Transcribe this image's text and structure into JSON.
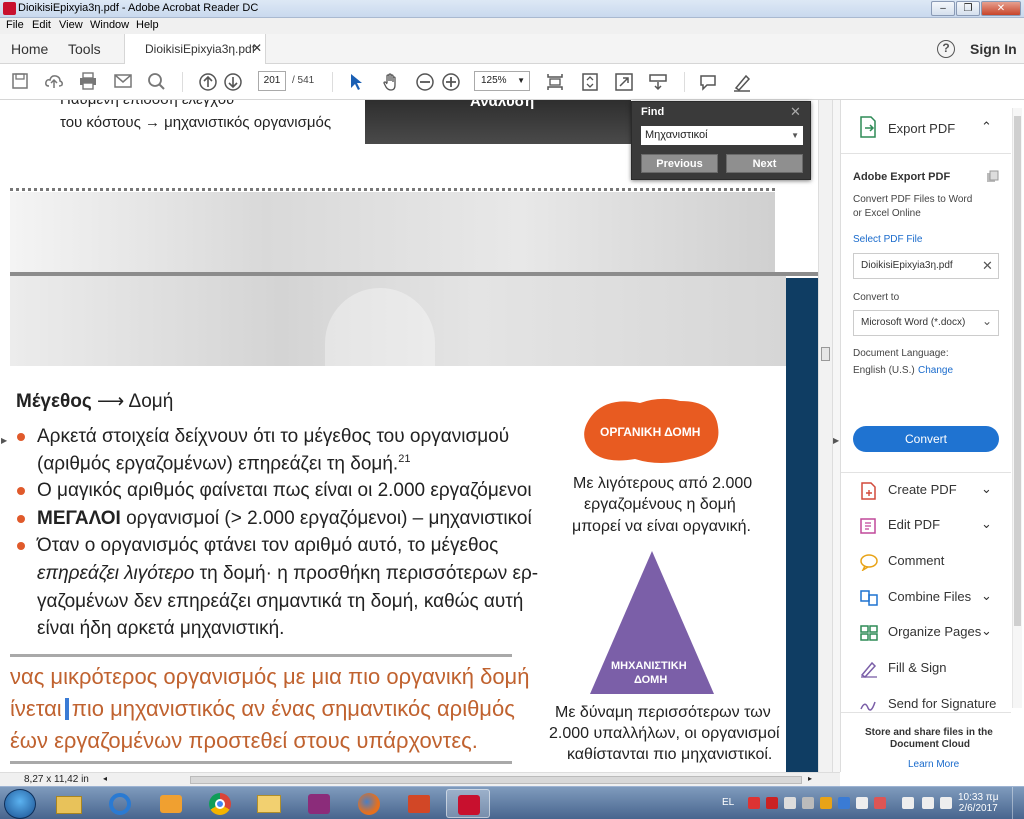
{
  "window": {
    "title": "DioikisiEpixyia3η.pdf - Adobe Acrobat Reader DC"
  },
  "menu": [
    "File",
    "Edit",
    "View",
    "Window",
    "Help"
  ],
  "tabs": {
    "home": "Home",
    "tools": "Tools",
    "doc": "DioikisiEpixyia3η.pdf",
    "sign_in": "Sign In"
  },
  "toolbar": {
    "page": "201",
    "page_total": "/ 541",
    "zoom": "125%"
  },
  "find": {
    "title": "Find",
    "value": "Μηχανιστικοί",
    "previous": "Previous",
    "next": "Next"
  },
  "doc": {
    "top_line1": "Ηαύμενη επίδοση ελέγχου",
    "top_line2": "του κόστους → μηχανιστικός οργανισμός",
    "top_dark_text": "Ανάλυση",
    "heading_bold": "Μέγεθος",
    "heading_arrow": "⟶",
    "heading_rest": "Δομή",
    "b1_l1": "Αρκετά στοιχεία δείχνουν ότι το μέγεθος του οργανισμού",
    "b1_l2": "(αριθμός εργαζομένων) επηρεάζει τη δομή.",
    "b1_sup": "21",
    "b2": "Ο μαγικός αριθμός φαίνεται πως είναι οι 2.000 εργαζόμενοι",
    "b3_bold": "ΜΕΓΑΛΟΙ",
    "b3_rest": " οργανισμοί (> 2.000 εργαζόμενοι) – μηχανιστικοί",
    "b4_l1": "Όταν ο οργανισμός φτάνει τον αριθμό αυτό, το μέγεθος",
    "b4_l2_ital": "επηρεάζει λιγότερο",
    "b4_l2_rest": " τη δομή· η προσθήκη περισσότερων ερ-",
    "b4_l3": "γαζομένων δεν επηρεάζει σημαντικά τη δομή, καθώς αυτή",
    "b4_l4": "είναι ήδη αρκετά μηχανιστική.",
    "quote_l1": "νας μικρότερος οργανισμός με μια πιο οργανική δομή",
    "quote_l2_a": "ίνεται",
    "quote_l2_b": "πιο μηχανιστικός αν ένας σημαντικός αριθμός",
    "quote_l3": "έων εργαζομένων προστεθεί στους υπάρχοντες.",
    "organic_label": "ΟΡΓΑΝΙΚΗ ΔΟΜΗ",
    "organic_cap1": "Με λιγότερους από 2.000",
    "organic_cap2": "εργαζομένους η δομή",
    "organic_cap3": "μπορεί να είναι οργανική.",
    "mech_label1": "ΜΗΧΑΝΙΣΤΙΚΗ",
    "mech_label2": "ΔΟΜΗ",
    "mech_cap1": "Με δύναμη περισσότερων των",
    "mech_cap2": "2.000 υπαλλήλων, οι οργανισμοί",
    "mech_cap3": "καθίστανται πιο μηχανιστικοί."
  },
  "panel": {
    "export_title": "Export PDF",
    "adobe_export": "Adobe Export PDF",
    "desc1": "Convert PDF Files to Word",
    "desc2": "or Excel Online",
    "select_file": "Select PDF File",
    "file_name": "DioikisiEpixyia3η.pdf",
    "convert_to": "Convert to",
    "format": "Microsoft Word (*.docx)",
    "doc_lang": "Document Language:",
    "lang_value": "English (U.S.)",
    "change": "Change",
    "convert_btn": "Convert",
    "tools": [
      "Create PDF",
      "Edit PDF",
      "Comment",
      "Combine Files",
      "Organize Pages",
      "Fill & Sign",
      "Send for Signature"
    ],
    "promo1": "Store and share files in the",
    "promo2": "Document Cloud",
    "learn_more": "Learn More"
  },
  "status": {
    "page_size": "8,27 x 11,42 in"
  },
  "taskbar": {
    "lang": "EL",
    "time": "10:33 πμ",
    "date": "2/6/2017"
  }
}
